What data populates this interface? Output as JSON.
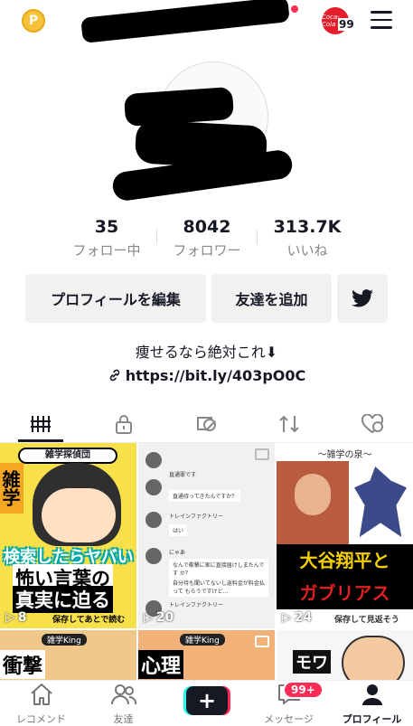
{
  "topbar": {
    "coin_symbol": "P",
    "brand_text": "Coca-Cola",
    "brand_count": "99"
  },
  "stats": [
    {
      "value": "35",
      "label": "フォロー中"
    },
    {
      "value": "8042",
      "label": "フォロワー"
    },
    {
      "value": "313.7K",
      "label": "いいね"
    }
  ],
  "buttons": {
    "edit_profile": "プロフィールを編集",
    "add_friends": "友達を追加"
  },
  "bio": "痩せるなら絶対これ⬇",
  "link": "https://bit.ly/403pO0C",
  "tabs": [
    "videos-tab",
    "private-tab",
    "hidden-tab",
    "repost-tab",
    "liked-tab"
  ],
  "videos": [
    {
      "banner": "雑学探偵団",
      "side": "雑学",
      "line1": "検索したらヤバい",
      "line2": "怖い言葉の",
      "line3": "真実に迫る",
      "footer": "保存してあとで読む",
      "views": "8"
    },
    {
      "chat": [
        "直通罪です",
        "直通待ってきたんですか？",
        "トレインファクトリー",
        "はい",
        "にゃあ",
        "なんで衝撃に家に直接届けしまたんです か？",
        "自分待も聞いてないし返料金が料金払って もらうですけど…",
        "トレインファクトリー"
      ],
      "views": "20"
    },
    {
      "banner": "～雑学の泉～",
      "line1": "大谷翔平と",
      "line2": "ガブリアス",
      "footer": "保存して見返そう",
      "views": "24"
    },
    {
      "banner": "雑学King",
      "title": "衝撃"
    },
    {
      "banner": "雑学King",
      "title": "心理"
    },
    {
      "title": "モワ"
    }
  ],
  "nav": [
    {
      "label": "レコメンド",
      "icon": "home-icon"
    },
    {
      "label": "友達",
      "icon": "friends-icon"
    },
    {
      "label": "",
      "icon": "plus-icon"
    },
    {
      "label": "メッセージ",
      "icon": "inbox-icon",
      "badge": "99+"
    },
    {
      "label": "プロフィール",
      "icon": "profile-icon"
    }
  ],
  "colors": {
    "accent": "#fe2c55",
    "cyan": "#25f4ee",
    "text": "#161823"
  }
}
